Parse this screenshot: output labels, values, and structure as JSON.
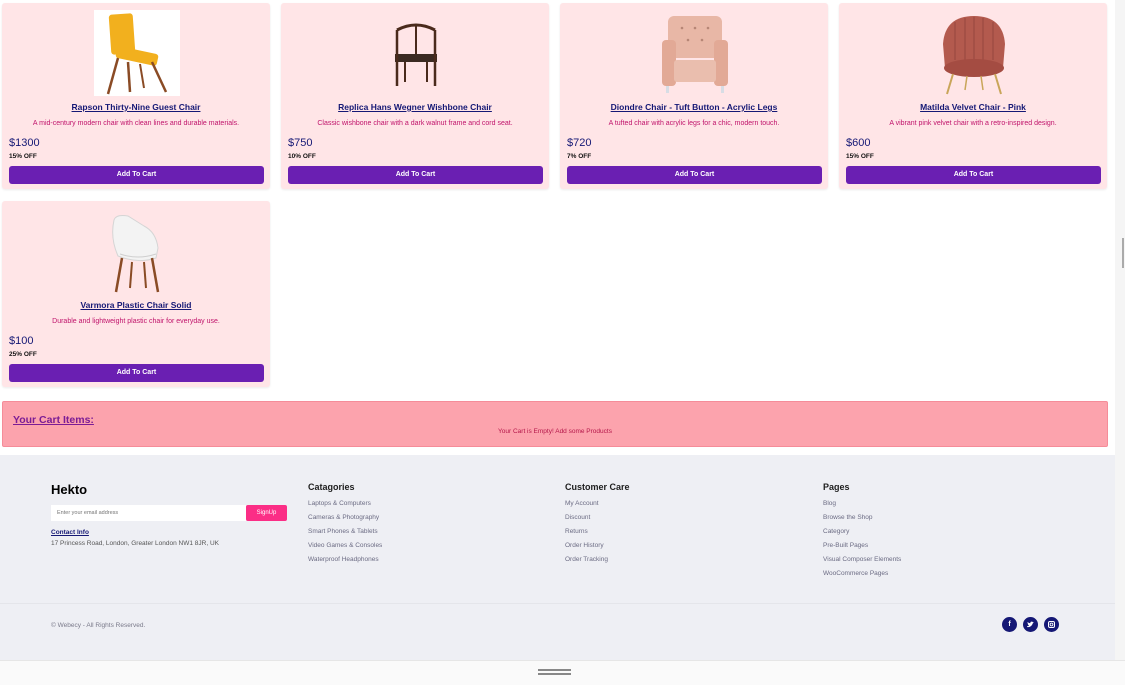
{
  "products": [
    {
      "name": "Rapson Thirty-Nine Guest Chair",
      "description": "A mid-century modern chair with clean lines and durable materials.",
      "price": "$1300",
      "discount": "15% OFF",
      "button": "Add To Cart",
      "icon": "yellow-chair-image"
    },
    {
      "name": "Replica Hans Wegner Wishbone Chair",
      "description": "Classic wishbone chair with a dark walnut frame and cord seat.",
      "price": "$750",
      "discount": "10% OFF",
      "button": "Add To Cart",
      "icon": "wishbone-chair-image"
    },
    {
      "name": "Diondre Chair - Tuft Button - Acrylic Legs",
      "description": "A tufted chair with acrylic legs for a chic, modern touch.",
      "price": "$720",
      "discount": "7% OFF",
      "button": "Add To Cart",
      "icon": "tufted-armchair-image"
    },
    {
      "name": "Matilda Velvet Chair - Pink",
      "description": "A vibrant pink velvet chair with a retro-inspired design.",
      "price": "$600",
      "discount": "15% OFF",
      "button": "Add To Cart",
      "icon": "velvet-chair-image"
    },
    {
      "name": "Varmora Plastic Chair Solid",
      "description": "Durable and lightweight plastic chair for everyday use.",
      "price": "$100",
      "discount": "25% OFF",
      "button": "Add To Cart",
      "icon": "plastic-chair-image"
    }
  ],
  "cart": {
    "title": "Your Cart Items:",
    "empty_message": "Your Cart is Empty! Add some Products"
  },
  "footer": {
    "brand": "Hekto",
    "email_placeholder": "Enter your email address",
    "signup": "SignUp",
    "contact_label": "Contact Info",
    "address": "17 Princess Road, London, Greater London NW1 8JR, UK",
    "columns": [
      {
        "heading": "Catagories",
        "items": [
          "Laptops & Computers",
          "Cameras & Photography",
          "Smart Phones & Tablets",
          "Video Games & Consoles",
          "Waterproof Headphones"
        ]
      },
      {
        "heading": "Customer Care",
        "items": [
          "My Account",
          "Discount",
          "Returns",
          "Order History",
          "Order Tracking"
        ]
      },
      {
        "heading": "Pages",
        "items": [
          "Blog",
          "Browse the Shop",
          "Category",
          "Pre-Built Pages",
          "Visual Composer Elements",
          "WooCommerce Pages"
        ]
      }
    ],
    "copyright": "© Webecy - All Rights Reserved.",
    "social": [
      "facebook-icon",
      "twitter-icon",
      "instagram-icon"
    ]
  },
  "colors": {
    "card_bg": "#ffe5e7",
    "button": "#6a1fb2",
    "cart_bg": "#fca3ad",
    "navy": "#151875",
    "pink": "#fb2e86"
  }
}
